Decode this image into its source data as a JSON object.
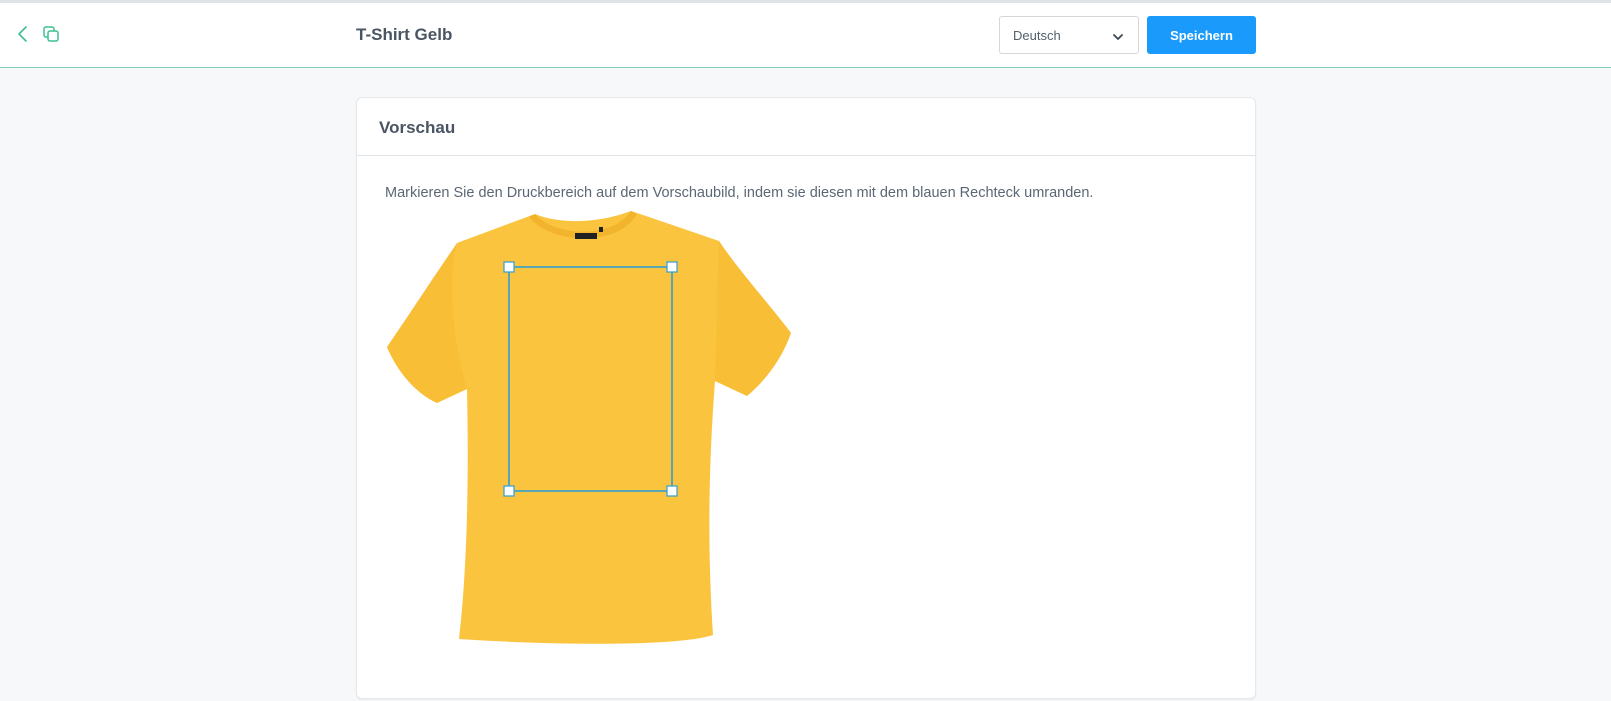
{
  "header": {
    "title": "T-Shirt Gelb",
    "back_icon": "chevron-left-icon",
    "duplicate_icon": "copy-icon",
    "language": {
      "selected": "Deutsch",
      "icon": "chevron-down-icon"
    },
    "save_label": "Speichern"
  },
  "card": {
    "title": "Vorschau",
    "hint": "Markieren Sie den Druckbereich auf dem Vorschaubild, indem sie diesen mit dem blauen Rechteck umranden.",
    "image_alt": "T-shirt icon",
    "shirt_color": "#fbc43f"
  },
  "colors": {
    "accent": "#1a9bfc",
    "icon_green": "#3fbf8f",
    "selection": "#2e9fd4"
  }
}
